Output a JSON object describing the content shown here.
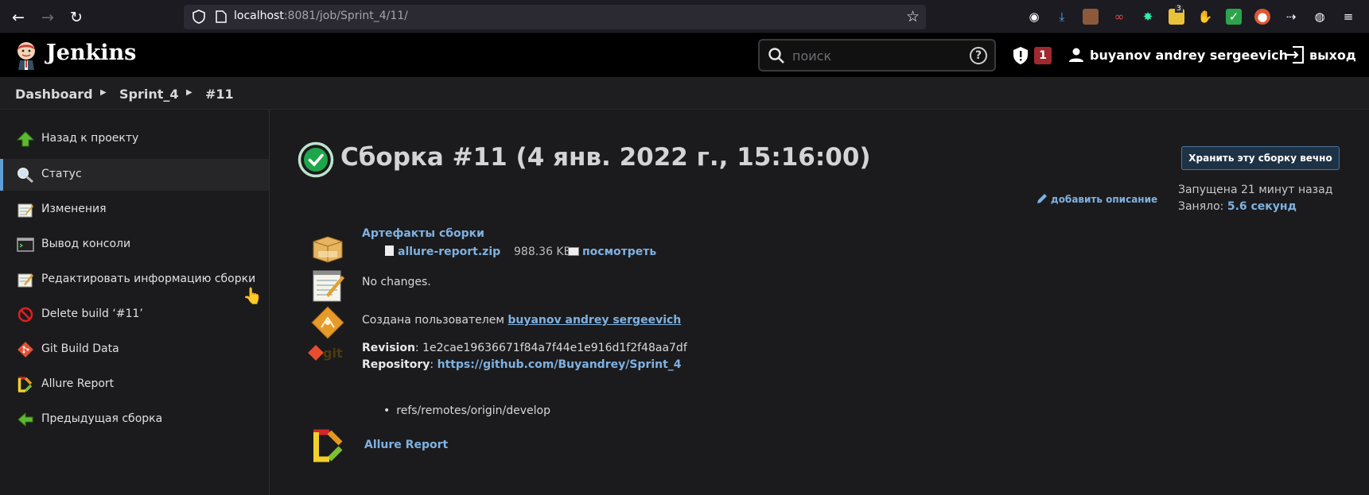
{
  "browser": {
    "url_host": "localhost",
    "url_rest": ":8081/job/Sprint_4/11/",
    "extension_badge": "3"
  },
  "header": {
    "title": "Jenkins",
    "search_placeholder": "поиск",
    "help": "?",
    "alerts_count": "1",
    "user_name": "buyanov andrey sergeevich",
    "logout_label": "выход"
  },
  "breadcrumb": {
    "items": [
      "Dashboard",
      "Sprint_4",
      "#11"
    ]
  },
  "sidebar": {
    "items": [
      {
        "label": "Назад к проекту",
        "icon": "up-arrow-icon"
      },
      {
        "label": "Статус",
        "icon": "search-icon"
      },
      {
        "label": "Изменения",
        "icon": "notepad-icon"
      },
      {
        "label": "Вывод консоли",
        "icon": "terminal-icon"
      },
      {
        "label": "Редактировать информацию сборки",
        "icon": "notepad-edit-icon"
      },
      {
        "label": "Delete build ‘#11’",
        "icon": "no-entry-icon"
      },
      {
        "label": "Git Build Data",
        "icon": "git-icon"
      },
      {
        "label": "Allure Report",
        "icon": "allure-icon"
      },
      {
        "label": "Предыдущая сборка",
        "icon": "left-arrow-icon"
      }
    ]
  },
  "build": {
    "title": "Сборка #11 (4 янв. 2022 г., 15:16:00)",
    "keep_button": "Хранить эту сборку вечно",
    "started": "Запущена 21 минут назад",
    "took_label": "Заняло:",
    "took_value": "5.6 секунд",
    "add_description": "добавить описание",
    "artifacts_title": "Артефакты сборки",
    "artifact_name": "allure-report.zip",
    "artifact_size": "988.36 KB",
    "artifact_view": "посмотреть",
    "no_changes": "No changes.",
    "created_by_label": "Создана пользователем",
    "created_by_user": "buyanov andrey sergeevich",
    "revision_label": "Revision",
    "revision_value": ": 1e2cae19636671f84a7f44e1e916d1f2f48aa7df",
    "repository_label": "Repository",
    "repository_value": "https://github.com/Buyandrey/Sprint_4",
    "branch": "refs/remotes/origin/develop",
    "allure_link": "Allure Report"
  },
  "colors": {
    "accent_link": "#7fb1e0",
    "success": "#1ea64b",
    "alert_badge": "#a0292f"
  }
}
